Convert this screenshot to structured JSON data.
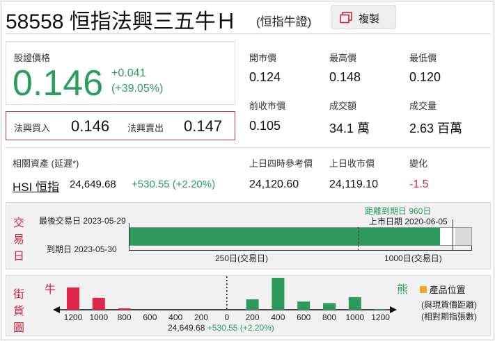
{
  "header": {
    "code_title": "58558 恒指法興三五牛Ｈ",
    "subtitle": "(恒指牛證)",
    "copy_label": "複製",
    "copy_icon": "copy-icon"
  },
  "quote": {
    "price_label": "股證價格",
    "price": "0.146",
    "change": "+0.041",
    "change_pct": "(+39.05%)",
    "bid_label": "法興買入",
    "bid": "0.146",
    "ask_label": "法興賣出",
    "ask": "0.147"
  },
  "stats": [
    {
      "label": "開市價",
      "value": "0.124"
    },
    {
      "label": "最高價",
      "value": "0.148"
    },
    {
      "label": "最低價",
      "value": "0.120"
    },
    {
      "label": "前收市價",
      "value": "0.105"
    },
    {
      "label": "成交額",
      "value": "34.1 萬"
    },
    {
      "label": "成交量",
      "value": "2.63 百萬"
    }
  ],
  "underlying": {
    "label": "相關資產 (延遲*)",
    "name": "HSI 恒指",
    "price": "24,649.68",
    "change": "+530.55 (+2.20%)",
    "ref_label": "上日四時參考價",
    "ref_value": "24,120.60",
    "close_label": "上日收市價",
    "close_value": "24,119.10",
    "diff_label": "變化",
    "diff_value": "-1.5"
  },
  "trading_days": {
    "side_label": [
      "交",
      "易",
      "日"
    ],
    "last_trading_label": "最後交易日 2023-05-29",
    "expiry_label": "到期日 2023-05-30",
    "days_to_expiry": "距離到期日 960日",
    "listing_label": "上市日期 2020-06-05",
    "mark_250": "250日(交易日)",
    "mark_1000": "1000日(交易日)",
    "progress_fraction": 0.94
  },
  "street": {
    "side_label": [
      "街",
      "貨",
      "圖"
    ],
    "bull_label": "牛",
    "bear_label": "熊",
    "legend_label": "產品位置",
    "note_line1": "(與現貨價距離)",
    "note_line2": "(相對期指張數)",
    "center_label": "0",
    "spot_price": "24,649.68",
    "spot_change": "+530.55 (+2.20%)",
    "colors": {
      "bull": "#e0264a",
      "bear": "#2d9a5c",
      "product": "#f5a623"
    }
  },
  "chart_data": {
    "type": "bar",
    "categories": [
      "1200",
      "1000",
      "800",
      "600",
      "400",
      "200",
      "0",
      "200",
      "400",
      "600",
      "800",
      "1000",
      "1200"
    ],
    "series": [
      {
        "values": [
          30,
          16,
          2,
          0,
          0,
          0,
          0,
          0,
          0,
          0,
          0,
          0,
          0
        ]
      },
      {
        "values": [
          0,
          0,
          0,
          0,
          0,
          0,
          0,
          14,
          43,
          11,
          9,
          17,
          1
        ]
      }
    ]
  }
}
